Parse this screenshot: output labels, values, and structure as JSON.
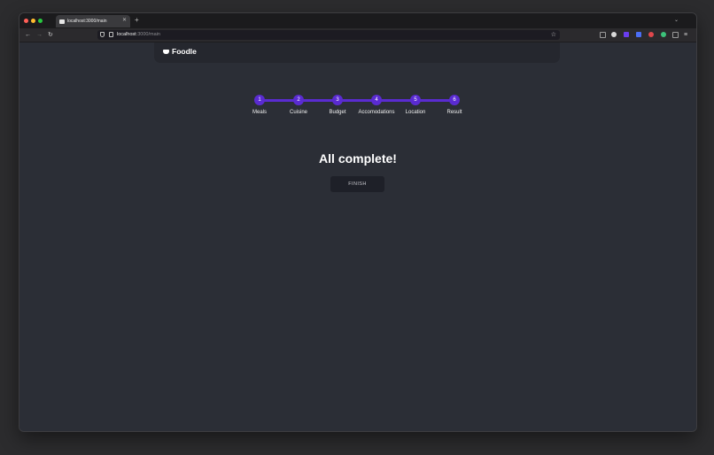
{
  "browser": {
    "tab_title": "localhost:3000/main",
    "tab_close_icon": "close-icon",
    "new_tab_icon": "plus-icon",
    "url_host": "localhost",
    "url_rest": ":3000/main",
    "nav_icons": [
      "back-arrow-icon",
      "forward-arrow-icon",
      "reload-icon"
    ],
    "extension_colors": [
      "#8a8a8a",
      "#d9d9d9",
      "#6a3df0",
      "#4b6ef5",
      "#e0474c",
      "#3cc27a",
      "#9a9a9a"
    ]
  },
  "app": {
    "logo_text": "Foodle",
    "logo_icon": "plate-icon",
    "accent_color": "#5a2bd1",
    "steps": [
      {
        "number": "1",
        "label": "Meals"
      },
      {
        "number": "2",
        "label": "Cuisine"
      },
      {
        "number": "3",
        "label": "Budget"
      },
      {
        "number": "4",
        "label": "Accomodations"
      },
      {
        "number": "5",
        "label": "Location"
      },
      {
        "number": "6",
        "label": "Result"
      }
    ],
    "heading": "All complete!",
    "finish_label": "FINISH"
  }
}
